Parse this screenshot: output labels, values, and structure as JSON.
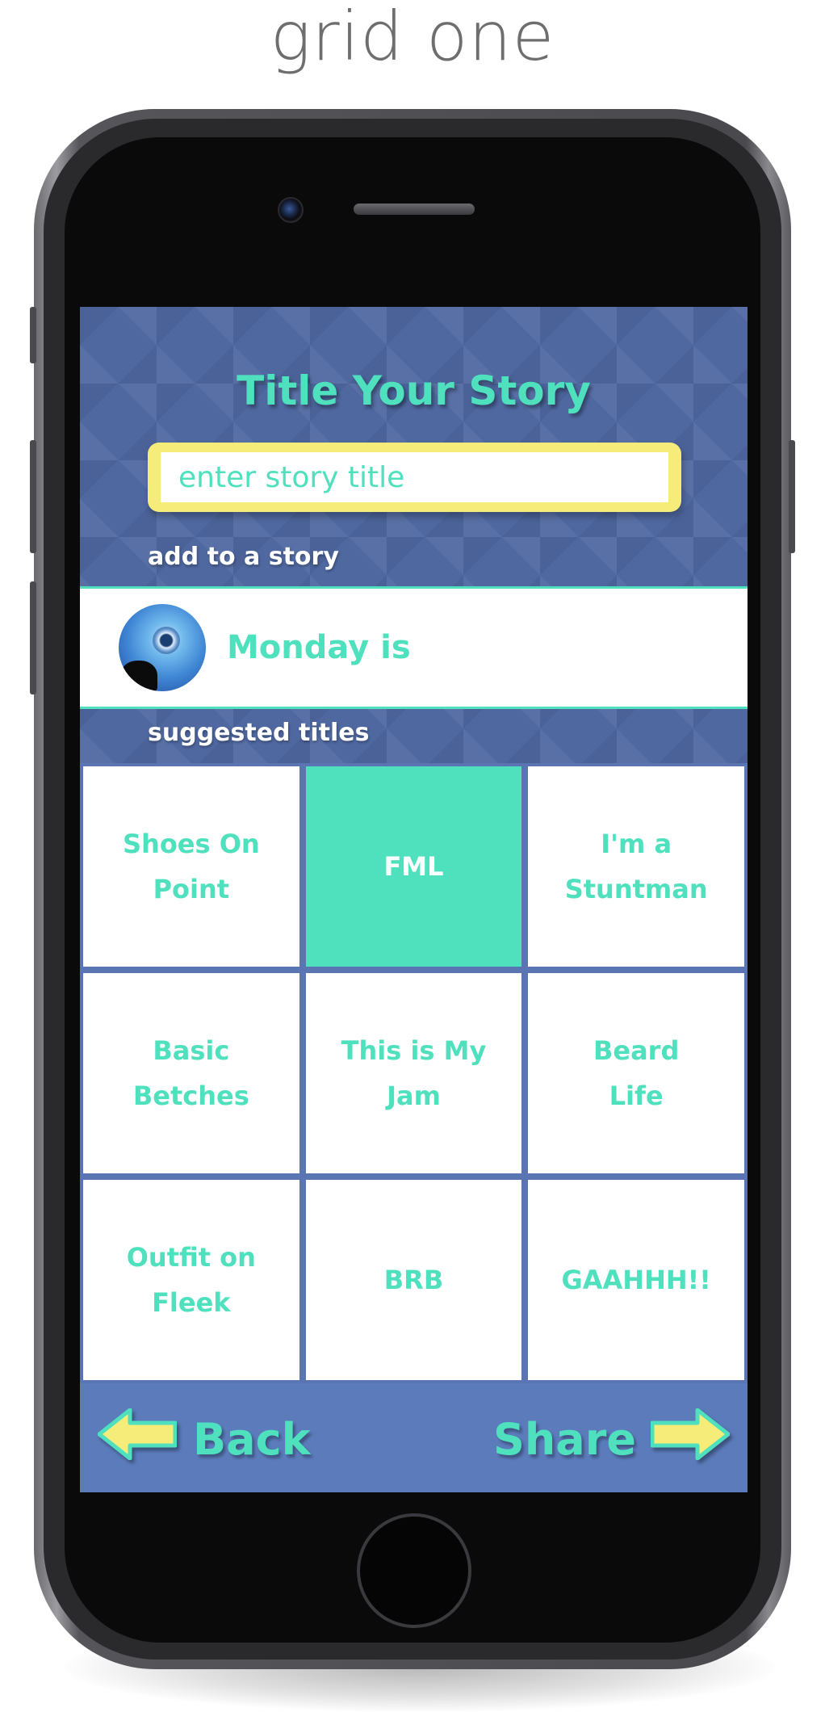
{
  "caption": "grid one",
  "screen": {
    "title": "Title Your Story",
    "title_input": {
      "placeholder": "enter story title",
      "value": ""
    },
    "add_label": "add to a story",
    "existing_story": {
      "name": "Monday is"
    },
    "suggested_label": "suggested titles",
    "suggestions": [
      {
        "label": "Shoes On\nPoint",
        "selected": false
      },
      {
        "label": "FML",
        "selected": true
      },
      {
        "label": "I'm a\nStuntman",
        "selected": false
      },
      {
        "label": "Basic\nBetches",
        "selected": false
      },
      {
        "label": "This is My\nJam",
        "selected": false
      },
      {
        "label": "Beard\nLife",
        "selected": false
      },
      {
        "label": "Outfit on\nFleek",
        "selected": false
      },
      {
        "label": "BRB",
        "selected": false
      },
      {
        "label": "GAAHHH!!",
        "selected": false
      }
    ],
    "back_label": "Back",
    "share_label": "Share"
  },
  "colors": {
    "accent": "#4fe0be",
    "background": "#4f68a0",
    "input_border": "#f5ec7a",
    "arrow": "#f5ec7a",
    "bottom_bar": "#5b7bbb"
  },
  "icons": {
    "back": "left-arrow-icon",
    "share": "right-arrow-icon"
  }
}
